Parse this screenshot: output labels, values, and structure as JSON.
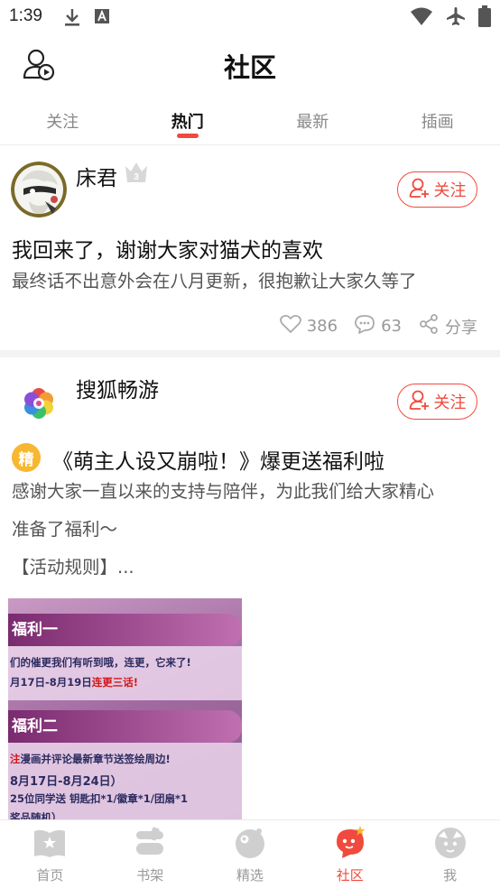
{
  "status_bar": {
    "time": "1:39",
    "left_icons": [
      "download-icon",
      "a-box-icon"
    ],
    "right_icons": [
      "wifi-icon",
      "airplane-icon",
      "battery-icon"
    ]
  },
  "header": {
    "title": "社区",
    "profile_icon": "profile-play-icon"
  },
  "tabs": [
    {
      "label": "关注",
      "active": false
    },
    {
      "label": "热门",
      "active": true
    },
    {
      "label": "最新",
      "active": false
    },
    {
      "label": "插画",
      "active": false
    }
  ],
  "posts": [
    {
      "author": "床君",
      "badge_level": "3",
      "follow_label": "关注",
      "title": "我回来了，谢谢大家对猫犬的喜欢",
      "body": "最终话不出意外会在八月更新，很抱歉让大家久等了",
      "likes": "386",
      "comments": "63",
      "share_label": "分享"
    },
    {
      "author": "搜狐畅游",
      "follow_label": "关注",
      "featured_badge": "精",
      "title": "《萌主人设又崩啦！》爆更送福利啦",
      "body_line1": "感谢大家一直以来的支持与陪伴，为此我们给大家精心",
      "body_line2": "准备了福利～",
      "body_line3": "【活动规则】...",
      "image": {
        "band1": "福利一",
        "line1": "们的催更我们有听到哦，连更，它来了!",
        "line2_prefix": "月17日-8月19日",
        "line2_red": "连更三话!",
        "band2": "福利二",
        "line3_red": "注",
        "line3": "漫画并评论最新章节送签绘周边!",
        "line4": "8月17日-8月24日）",
        "line5": "25位同学送 钥匙扣*1/徽章*1/团扇*1",
        "line6": "奖品随机）"
      }
    }
  ],
  "bottom_nav": [
    {
      "label": "首页",
      "icon": "home-book-icon",
      "active": false
    },
    {
      "label": "书架",
      "icon": "bookshelf-icon",
      "active": false
    },
    {
      "label": "精选",
      "icon": "featured-icon",
      "active": false
    },
    {
      "label": "社区",
      "icon": "community-icon",
      "active": true
    },
    {
      "label": "我",
      "icon": "me-icon",
      "active": false
    }
  ],
  "colors": {
    "accent": "#f04a3e",
    "text_primary": "#111111",
    "text_secondary": "#555555",
    "muted": "#999999",
    "featured": "#f7b731"
  }
}
